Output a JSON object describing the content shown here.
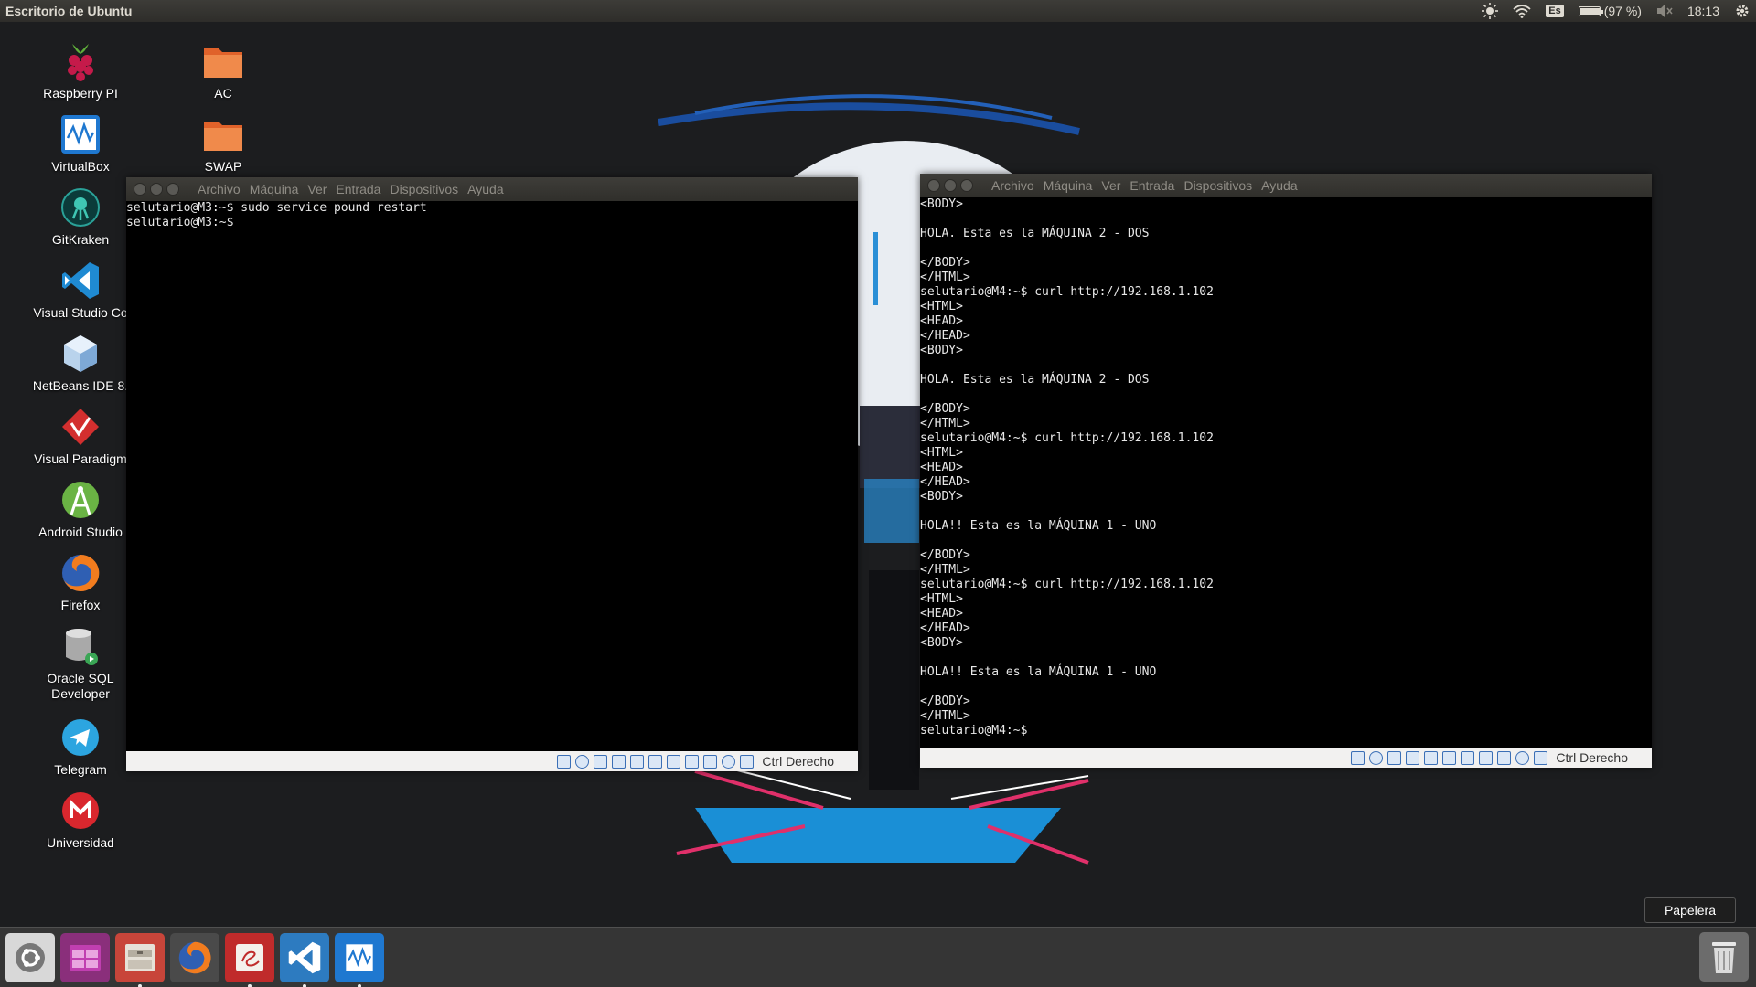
{
  "top_panel": {
    "title": "Escritorio de Ubuntu",
    "keyboard_layout": "Es",
    "battery_text": "(97 %)",
    "battery_level": 0.97,
    "clock": "18:13"
  },
  "desktop_icons": [
    {
      "label": "Raspberry PI",
      "icon": "raspberry-pi-icon"
    },
    {
      "label": "AC",
      "icon": "folder-icon"
    },
    {
      "label": "VirtualBox",
      "icon": "virtualbox-icon"
    },
    {
      "label": "SWAP",
      "icon": "folder-icon"
    },
    {
      "label": "GitKraken",
      "icon": "gitkraken-icon"
    },
    {
      "label": "Visual Studio Co",
      "icon": "vscode-icon"
    },
    {
      "label": "NetBeans IDE 8.",
      "icon": "netbeans-icon"
    },
    {
      "label": "Visual Paradigm",
      "icon": "visual-paradigm-icon"
    },
    {
      "label": "Android Studio",
      "icon": "android-studio-icon"
    },
    {
      "label": "Firefox",
      "icon": "firefox-icon"
    },
    {
      "label": "Oracle SQL\nDeveloper",
      "icon": "oracle-sql-icon"
    },
    {
      "label": "Telegram",
      "icon": "telegram-icon"
    },
    {
      "label": "Universidad",
      "icon": "mega-icon"
    }
  ],
  "vbox_menu": [
    "Archivo",
    "Máquina",
    "Ver",
    "Entrada",
    "Dispositivos",
    "Ayuda"
  ],
  "host_key": "Ctrl Derecho",
  "window_m3": {
    "terminal": "selutario@M3:~$ sudo service pound restart\nselutario@M3:~$"
  },
  "window_m4": {
    "terminal": "<BODY>\n\nHOLA. Esta es la MÁQUINA 2 - DOS\n\n</BODY>\n</HTML>\nselutario@M4:~$ curl http://192.168.1.102\n<HTML>\n<HEAD>\n</HEAD>\n<BODY>\n\nHOLA. Esta es la MÁQUINA 2 - DOS\n\n</BODY>\n</HTML>\nselutario@M4:~$ curl http://192.168.1.102\n<HTML>\n<HEAD>\n</HEAD>\n<BODY>\n\nHOLA!! Esta es la MÁQUINA 1 - UNO\n\n</BODY>\n</HTML>\nselutario@M4:~$ curl http://192.168.1.102\n<HTML>\n<HEAD>\n</HEAD>\n<BODY>\n\nHOLA!! Esta es la MÁQUINA 1 - UNO\n\n</BODY>\n</HTML>\nselutario@M4:~$"
  },
  "launcher": [
    {
      "icon": "ubuntu-dash-icon",
      "bg": "#d8d8d8"
    },
    {
      "icon": "workspace-switcher-icon",
      "bg": "#8a2f7b"
    },
    {
      "icon": "file-manager-icon",
      "bg": "#c8453a"
    },
    {
      "icon": "firefox-icon",
      "bg": "#4a4a4a"
    },
    {
      "icon": "text-editor-icon",
      "bg": "#c02b2b"
    },
    {
      "icon": "vscode-icon",
      "bg": "#2d7bc0"
    },
    {
      "icon": "virtualbox-icon",
      "bg": "#1f78d0"
    }
  ],
  "trash": {
    "tooltip": "Papelera"
  }
}
